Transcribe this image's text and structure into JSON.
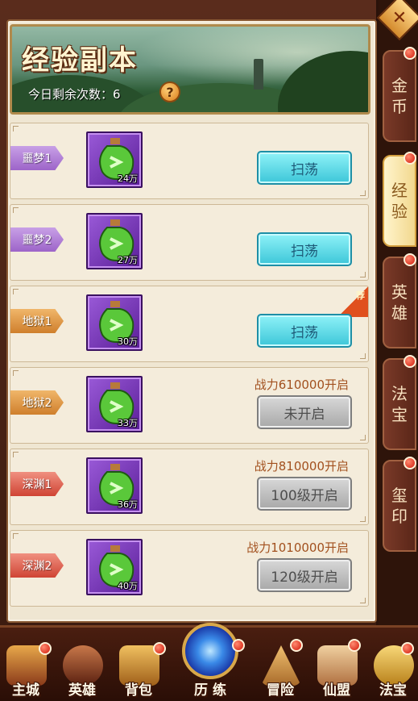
{
  "header": {
    "title": "经验副本",
    "remaining_label": "今日剩余次数：6",
    "help_glyph": "?"
  },
  "close_glyph": "✕",
  "rows": [
    {
      "tag": "噩梦1",
      "tag_color": "purple",
      "reward": "24万",
      "button": "扫荡",
      "state": "active",
      "requirement": ""
    },
    {
      "tag": "噩梦2",
      "tag_color": "purple",
      "reward": "27万",
      "button": "扫荡",
      "state": "active",
      "requirement": ""
    },
    {
      "tag": "地狱1",
      "tag_color": "orange",
      "reward": "30万",
      "button": "扫荡",
      "state": "active",
      "requirement": "",
      "badge": "荐"
    },
    {
      "tag": "地狱2",
      "tag_color": "orange",
      "reward": "33万",
      "button": "未开启",
      "state": "locked",
      "requirement": "战力610000开启"
    },
    {
      "tag": "深渊1",
      "tag_color": "red",
      "reward": "36万",
      "button": "100级开启",
      "state": "locked",
      "requirement": "战力810000开启"
    },
    {
      "tag": "深渊2",
      "tag_color": "red",
      "reward": "40万",
      "button": "120级开启",
      "state": "locked",
      "requirement": "战力1010000开启"
    }
  ],
  "side_tabs": [
    {
      "line1": "金",
      "line2": "币",
      "active": false
    },
    {
      "line1": "经",
      "line2": "验",
      "active": true
    },
    {
      "line1": "英",
      "line2": "雄",
      "active": false
    },
    {
      "line1": "法",
      "line2": "宝",
      "active": false
    },
    {
      "line1": "玺",
      "line2": "印",
      "active": false
    }
  ],
  "bottom_nav": [
    {
      "label": "主城",
      "icon": "castle-icon"
    },
    {
      "label": "英雄",
      "icon": "hero-icon"
    },
    {
      "label": "背包",
      "icon": "bag-icon"
    },
    {
      "label": "历 练",
      "icon": "portal-icon"
    },
    {
      "label": "冒险",
      "icon": "mountain-icon"
    },
    {
      "label": "仙盟",
      "icon": "guild-icon"
    },
    {
      "label": "法宝",
      "icon": "treasure-icon"
    }
  ],
  "colors": {
    "panel_bg": "#efe6d2",
    "button_active": "#3cc6d8",
    "button_locked": "#a8a8a8",
    "requirement_text": "#a2501e",
    "notification_dot": "#d21a0a"
  }
}
